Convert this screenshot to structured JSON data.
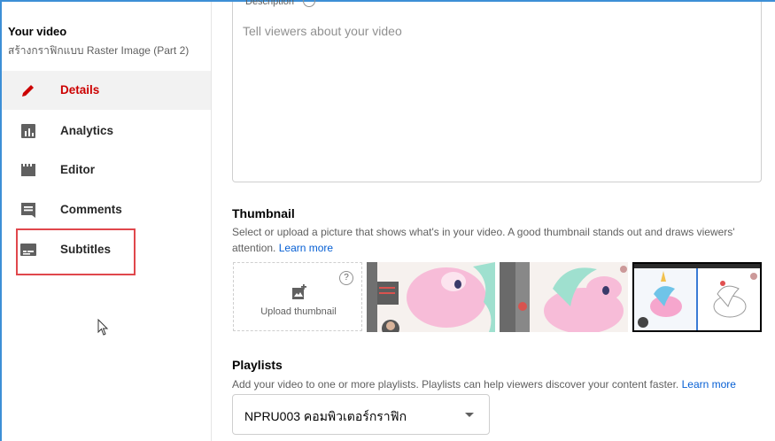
{
  "sidebar": {
    "title": "Your video",
    "subtitle": "สร้างกราฟิกแบบ Raster Image (Part 2)",
    "items": [
      {
        "label": "Details",
        "icon": "pencil-icon",
        "active": true
      },
      {
        "label": "Analytics",
        "icon": "analytics-icon",
        "active": false
      },
      {
        "label": "Editor",
        "icon": "editor-icon",
        "active": false
      },
      {
        "label": "Comments",
        "icon": "comments-icon",
        "active": false
      },
      {
        "label": "Subtitles",
        "icon": "subtitles-icon",
        "active": false
      }
    ]
  },
  "description": {
    "label": "Description",
    "placeholder": "Tell viewers about your video"
  },
  "thumbnail": {
    "title": "Thumbnail",
    "desc": "Select or upload a picture that shows what's in your video. A good thumbnail stands out and draws viewers' attention.",
    "learn_more": "Learn more",
    "upload_label": "Upload thumbnail",
    "help": "?"
  },
  "playlists": {
    "title": "Playlists",
    "desc": "Add your video to one or more playlists. Playlists can help viewers discover your content faster.",
    "learn_more": "Learn more",
    "selected": "NPRU003 คอมพิวเตอร์กราฟิก"
  },
  "colors": {
    "accent_red": "#cc0000",
    "link_blue": "#065fd4",
    "highlight": "#e0474c"
  }
}
